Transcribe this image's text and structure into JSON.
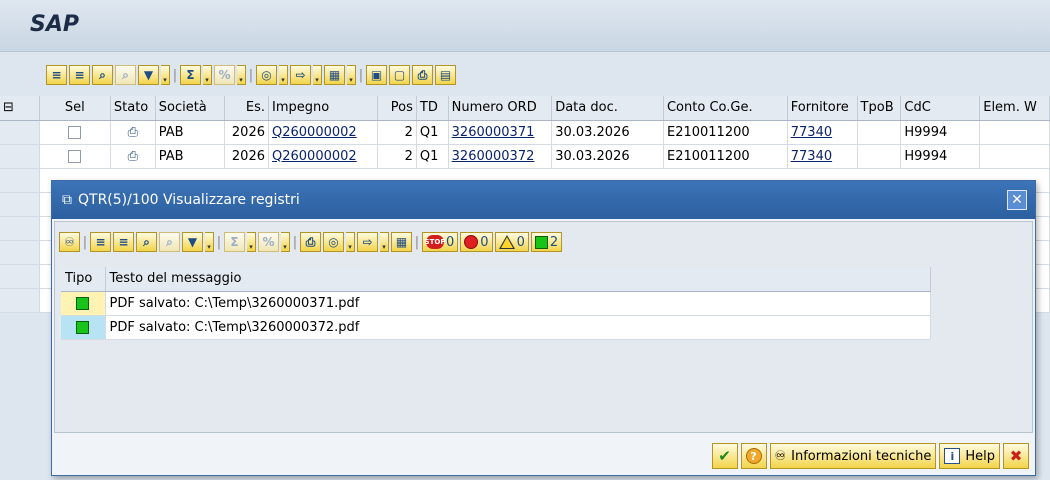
{
  "app": {
    "logo": "SAP"
  },
  "grid": {
    "columns": [
      "Sel",
      "Stato",
      "Società",
      "Es.",
      "Impegno",
      "Pos",
      "TD",
      "Numero ORD",
      "Data doc.",
      "Conto Co.Ge.",
      "Fornitore",
      "TpoB",
      "CdC",
      "Elem. W"
    ],
    "rows": [
      {
        "societa": "PAB",
        "es": "2026",
        "impegno": "Q260000002",
        "pos": "2",
        "td": "Q1",
        "numero_ord": "3260000371",
        "data_doc": "30.03.2026",
        "conto": "E210011200",
        "fornitore": "77340",
        "tpob": "",
        "cdc": "H9994"
      },
      {
        "societa": "PAB",
        "es": "2026",
        "impegno": "Q260000002",
        "pos": "2",
        "td": "Q1",
        "numero_ord": "3260000372",
        "data_doc": "30.03.2026",
        "conto": "E210011200",
        "fornitore": "77340",
        "tpob": "",
        "cdc": "H9994"
      }
    ]
  },
  "dialog": {
    "title": "QTR(5)/100 Visualizzare registri",
    "counts": {
      "stop": "0",
      "error": "0",
      "warning": "0",
      "success": "2"
    },
    "columns": {
      "tipo": "Tipo",
      "testo": "Testo del messaggio"
    },
    "messages": [
      {
        "text": "PDF salvato: C:\\Temp\\3260000371.pdf"
      },
      {
        "text": "PDF salvato: C:\\Temp\\3260000372.pdf"
      }
    ],
    "footer": {
      "tech_info": "Informazioni tecniche",
      "help": "Help"
    }
  }
}
